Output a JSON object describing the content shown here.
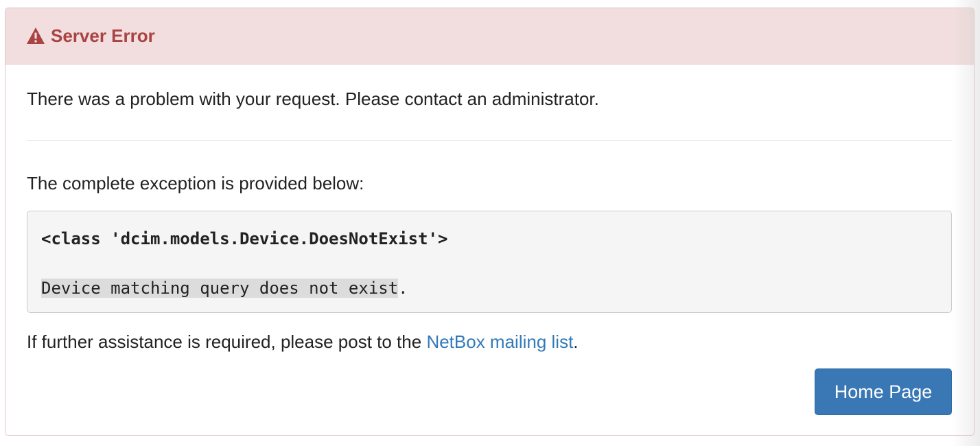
{
  "panel": {
    "title": "Server Error",
    "icon": "warning-icon",
    "colors": {
      "heading_bg": "#f2dede",
      "heading_text": "#a94442",
      "link": "#337ab7",
      "button_bg": "#3a78b5"
    }
  },
  "body": {
    "intro": "There was a problem with your request. Please contact an administrator.",
    "exception_label": "The complete exception is provided below:",
    "exception_type": "<class 'dcim.models.Device.DoesNotExist'>",
    "exception_message": "Device matching query does not exist",
    "exception_message_suffix": ".",
    "assist_prefix": "If further assistance is required, please post to the ",
    "assist_link": "NetBox mailing list",
    "assist_suffix": "."
  },
  "actions": {
    "home_label": "Home Page"
  }
}
